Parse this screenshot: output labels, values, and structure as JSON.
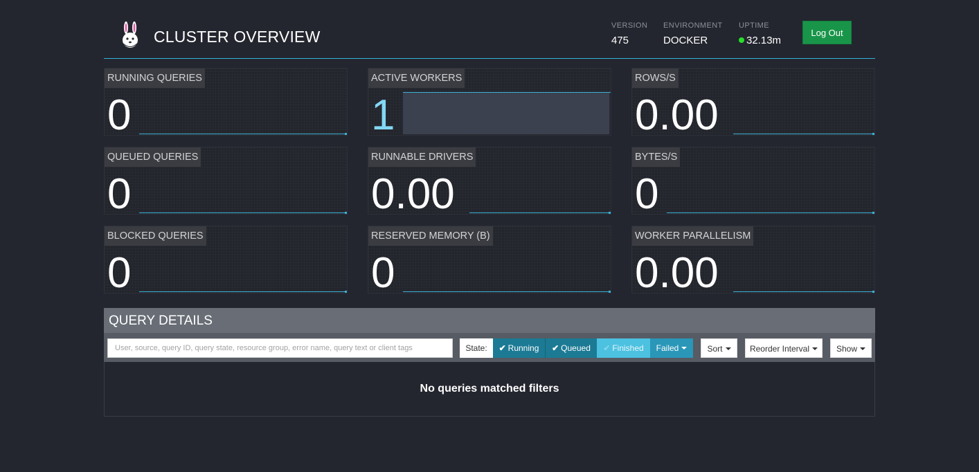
{
  "header": {
    "title": "CLUSTER OVERVIEW",
    "logo_icon": "bunny-logo-icon",
    "version": {
      "label": "VERSION",
      "value": "475"
    },
    "environment": {
      "label": "ENVIRONMENT",
      "value": "DOCKER"
    },
    "uptime": {
      "label": "UPTIME",
      "value": "32.13m",
      "status_color": "#26e028"
    },
    "logout_label": "Log Out"
  },
  "stats": {
    "running_queries": {
      "label": "RUNNING QUERIES",
      "value": "0"
    },
    "active_workers": {
      "label": "ACTIVE WORKERS",
      "value": "1"
    },
    "rows_per_sec": {
      "label": "ROWS/S",
      "value": "0.00"
    },
    "queued_queries": {
      "label": "QUEUED QUERIES",
      "value": "0"
    },
    "runnable_drivers": {
      "label": "RUNNABLE DRIVERS",
      "value": "0.00"
    },
    "bytes_per_sec": {
      "label": "BYTES/S",
      "value": "0"
    },
    "blocked_queries": {
      "label": "BLOCKED QUERIES",
      "value": "0"
    },
    "reserved_memory": {
      "label": "RESERVED MEMORY (B)",
      "value": "0"
    },
    "worker_parallelism": {
      "label": "WORKER PARALLELISM",
      "value": "0.00"
    }
  },
  "query_details": {
    "title": "QUERY DETAILS",
    "search": {
      "placeholder": "User, source, query ID, query state, resource group, error name, query text or client tags",
      "value": ""
    },
    "state_label": "State:",
    "state_filters": [
      {
        "label": "Running",
        "active": true
      },
      {
        "label": "Queued",
        "active": true
      },
      {
        "label": "Finished",
        "active": false
      },
      {
        "label": "Failed",
        "active": true
      }
    ],
    "sort_label": "Sort",
    "reorder_label": "Reorder Interval",
    "show_label": "Show",
    "empty_message": "No queries matched filters"
  },
  "colors": {
    "background": "#24262f",
    "accent": "#2fb3d9",
    "logout": "#199549",
    "filter_active": "#1c7a94",
    "filter_inactive": "#4cc1e0"
  }
}
